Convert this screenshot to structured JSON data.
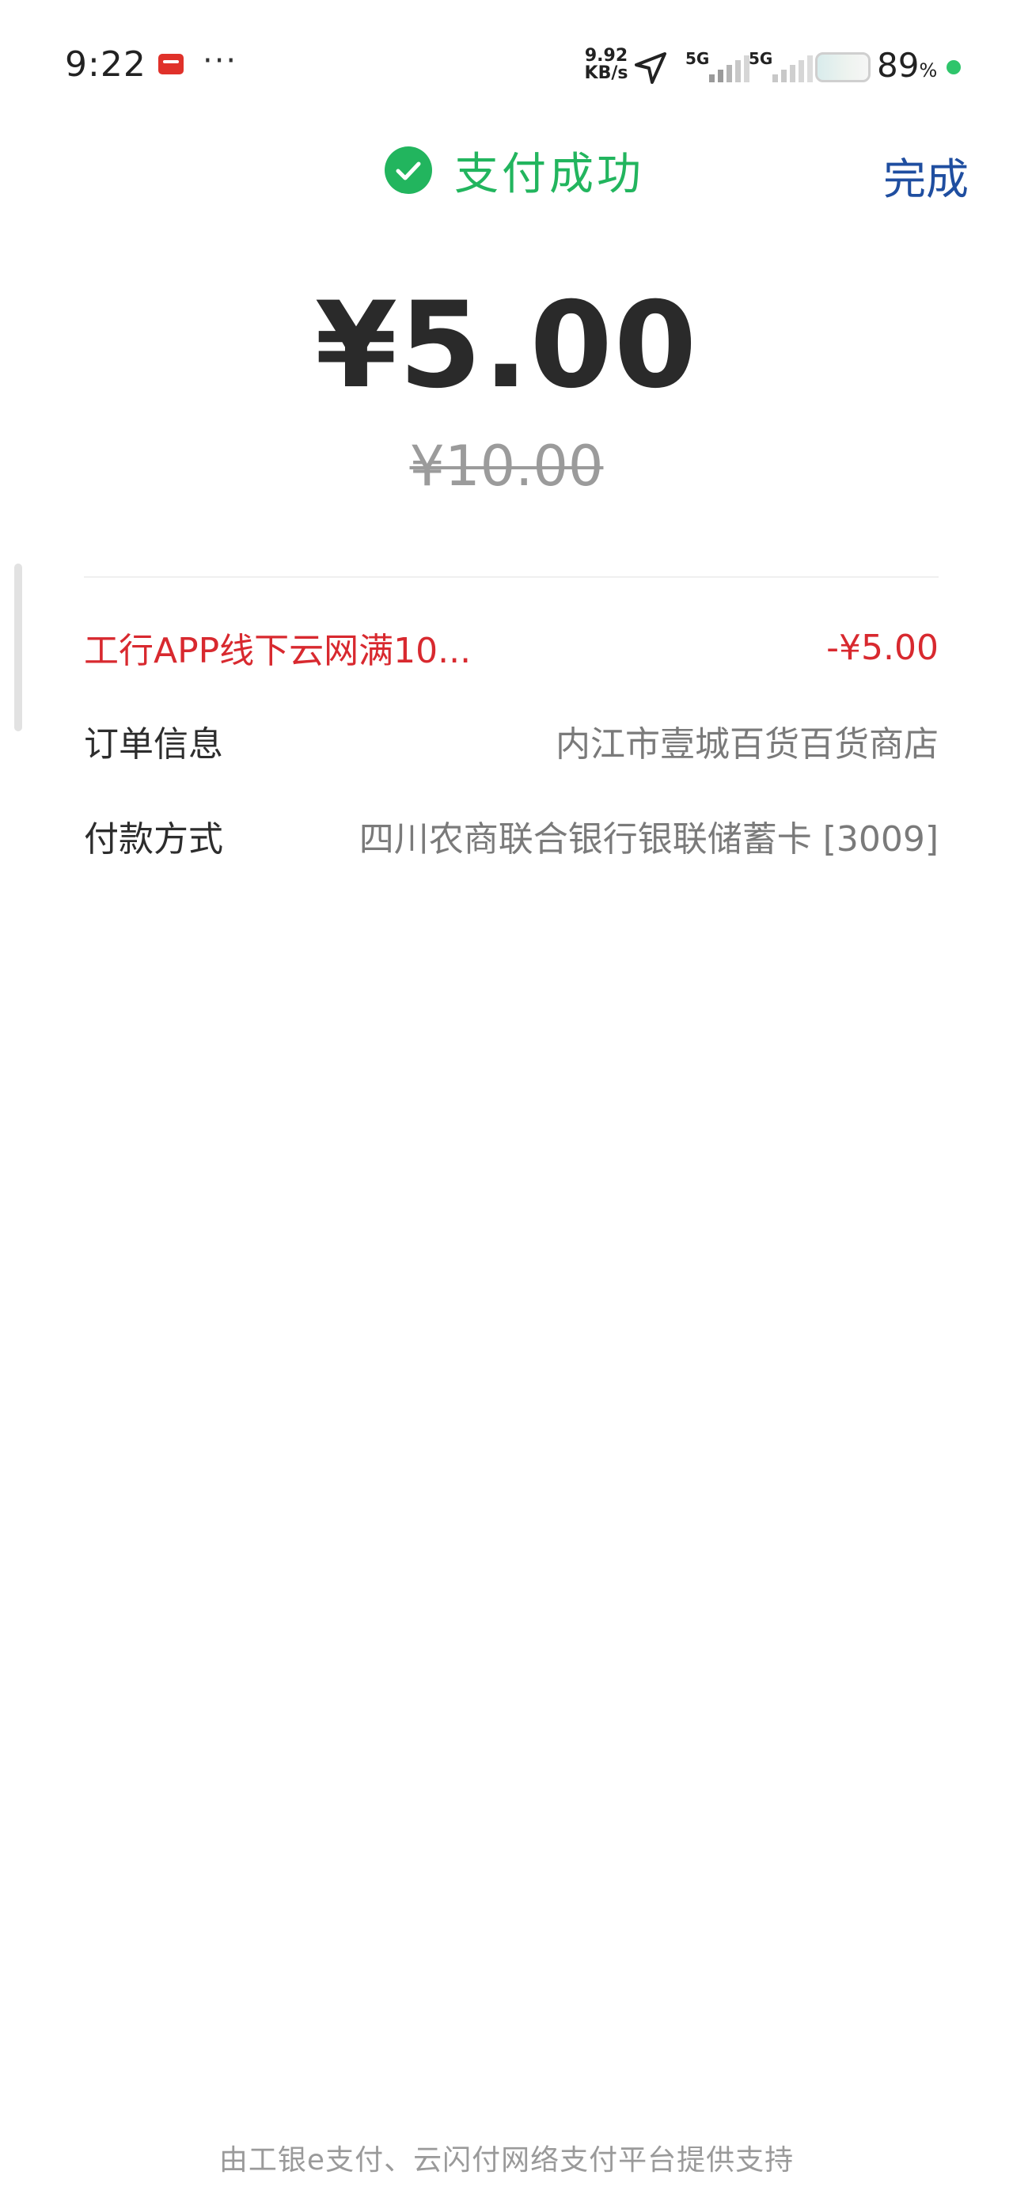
{
  "status_bar": {
    "time": "9:22",
    "app_icon": "icbc-app-icon",
    "more_dots": "···",
    "net_speed_value": "9.92",
    "net_speed_unit": "KB/s",
    "sim1_tag": "5G",
    "sim2_tag": "5G",
    "battery_percent": "89",
    "battery_percent_sign": "%",
    "battery_dot_color": "#2fc56b"
  },
  "header": {
    "status_text": "支付成功",
    "status_icon": "check-circle-icon",
    "status_color": "#22b55e",
    "done_label": "完成",
    "done_color": "#1f4ea0"
  },
  "payment": {
    "amount": "¥5.00",
    "original_amount": "¥10.00"
  },
  "details": {
    "discount_label": "工行APP线下云网满10...",
    "discount_value": "-¥5.00",
    "discount_color": "#d8292f",
    "order_label": "订单信息",
    "order_value": "内江市壹城百货百货商店",
    "method_label": "付款方式",
    "method_value": "四川农商联合银行银联储蓄卡 [3009]"
  },
  "footer": {
    "text": "由工银e支付、云闪付网络支付平台提供支持"
  }
}
